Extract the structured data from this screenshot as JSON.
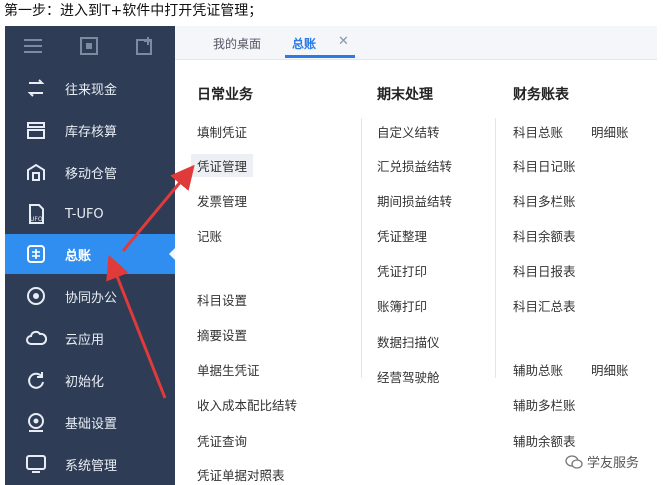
{
  "caption": "第一步：进入到T+软件中打开凭证管理；",
  "sidebar": {
    "items": [
      {
        "label": "往来现金",
        "icon": "cash-icon"
      },
      {
        "label": "库存核算",
        "icon": "inventory-icon"
      },
      {
        "label": "移动仓管",
        "icon": "mobile-warehouse-icon"
      },
      {
        "label": "T-UFO",
        "icon": "ufo-icon"
      },
      {
        "label": "总账",
        "icon": "ledger-icon",
        "active": true
      },
      {
        "label": "协同办公",
        "icon": "collab-icon"
      },
      {
        "label": "云应用",
        "icon": "cloud-icon"
      },
      {
        "label": "初始化",
        "icon": "init-icon"
      },
      {
        "label": "基础设置",
        "icon": "settings-icon"
      },
      {
        "label": "系统管理",
        "icon": "system-icon"
      }
    ]
  },
  "tabs": [
    {
      "label": "我的桌面",
      "active": false
    },
    {
      "label": "总账",
      "active": true
    }
  ],
  "columns": {
    "daily": {
      "title": "日常业务",
      "items": [
        "填制凭证",
        "凭证管理",
        "发票管理",
        "记账",
        "科目设置",
        "摘要设置",
        "单据生凭证",
        "收入成本配比结转",
        "凭证查询",
        "凭证单据对照表"
      ]
    },
    "period_end": {
      "title": "期末处理",
      "items": [
        "自定义结转",
        "汇兑损益结转",
        "期间损益结转",
        "凭证整理",
        "凭证打印",
        "账簿打印",
        "数据扫描仪",
        "经营驾驶舱"
      ]
    },
    "books": {
      "title": "财务账表",
      "items": [
        "科目总账",
        "明细账",
        "科目日记账",
        "科目多栏账",
        "科目余额表",
        "科目日报表",
        "科目汇总表",
        "辅助总账",
        "明细账",
        "辅助多栏账",
        "辅助余额表"
      ]
    }
  },
  "watermark": "学友服务",
  "colors": {
    "sidebar": "#2e3d55",
    "active": "#2f8ef0",
    "arrow": "#e03a3a",
    "tab_active": "#2c7be5"
  }
}
